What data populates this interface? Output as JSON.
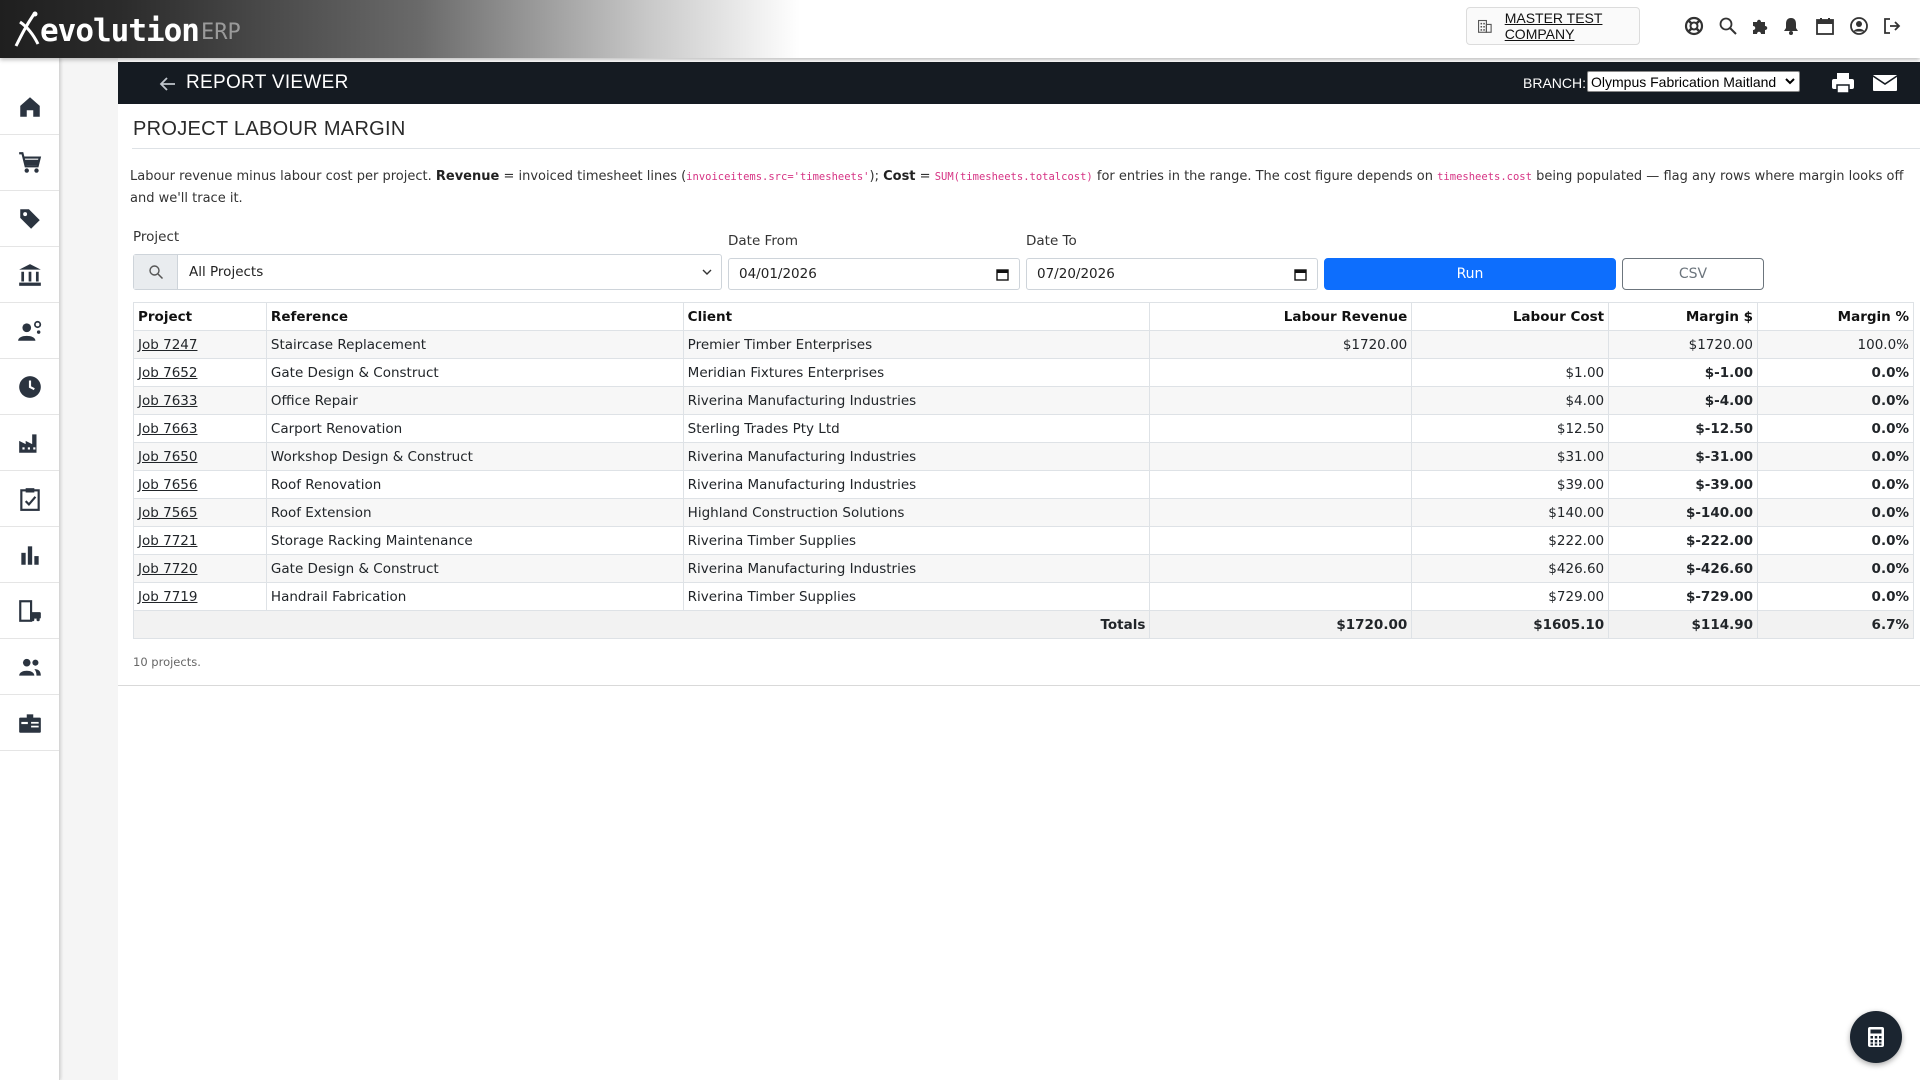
{
  "app": {
    "logo_main": "evolution",
    "logo_sub": "ERP",
    "company_name": "MASTER TEST COMPANY"
  },
  "header": {
    "title": "REPORT VIEWER",
    "branch_label": "BRANCH:",
    "branch_value": "Olympus Fabrication Maitland"
  },
  "report": {
    "title": "PROJECT LABOUR MARGIN",
    "description": {
      "t1": "Labour revenue minus labour cost per project. ",
      "revenue_label": "Revenue",
      "t2": " = invoiced timesheet lines (",
      "code1": "invoiceitems.src='timesheets'",
      "t3": "); ",
      "cost_label": "Cost",
      "t4": " = ",
      "code2": "SUM(timesheets.totalcost)",
      "t5": " for entries in the range. The cost figure depends on ",
      "code3": "timesheets.cost",
      "t6": " being populated — flag any rows where margin looks off and we'll trace it."
    },
    "filters": {
      "project_label": "Project",
      "project_value": "All Projects",
      "date_from_label": "Date From",
      "date_from_value": "04/01/2026",
      "date_to_label": "Date To",
      "date_to_value": "07/20/2026",
      "run_label": "Run",
      "csv_label": "CSV"
    },
    "columns": [
      "Project",
      "Reference",
      "Client",
      "Labour Revenue",
      "Labour Cost",
      "Margin $",
      "Margin %"
    ],
    "rows": [
      {
        "project": "Job 7247",
        "reference": "Staircase Replacement",
        "client": "Premier Timber Enterprises",
        "revenue": "$1720.00",
        "cost": "",
        "margin": "$1720.00",
        "pct": "100.0%",
        "negative": false
      },
      {
        "project": "Job 7652",
        "reference": "Gate Design & Construct",
        "client": "Meridian Fixtures Enterprises",
        "revenue": "",
        "cost": "$1.00",
        "margin": "$-1.00",
        "pct": "0.0%",
        "negative": true
      },
      {
        "project": "Job 7633",
        "reference": "Office Repair",
        "client": "Riverina Manufacturing Industries",
        "revenue": "",
        "cost": "$4.00",
        "margin": "$-4.00",
        "pct": "0.0%",
        "negative": true
      },
      {
        "project": "Job 7663",
        "reference": "Carport Renovation",
        "client": "Sterling Trades Pty Ltd",
        "revenue": "",
        "cost": "$12.50",
        "margin": "$-12.50",
        "pct": "0.0%",
        "negative": true
      },
      {
        "project": "Job 7650",
        "reference": "Workshop Design & Construct",
        "client": "Riverina Manufacturing Industries",
        "revenue": "",
        "cost": "$31.00",
        "margin": "$-31.00",
        "pct": "0.0%",
        "negative": true
      },
      {
        "project": "Job 7656",
        "reference": "Roof Renovation",
        "client": "Riverina Manufacturing Industries",
        "revenue": "",
        "cost": "$39.00",
        "margin": "$-39.00",
        "pct": "0.0%",
        "negative": true
      },
      {
        "project": "Job 7565",
        "reference": "Roof Extension",
        "client": "Highland Construction Solutions",
        "revenue": "",
        "cost": "$140.00",
        "margin": "$-140.00",
        "pct": "0.0%",
        "negative": true
      },
      {
        "project": "Job 7721",
        "reference": "Storage Racking Maintenance",
        "client": "Riverina Timber Supplies",
        "revenue": "",
        "cost": "$222.00",
        "margin": "$-222.00",
        "pct": "0.0%",
        "negative": true
      },
      {
        "project": "Job 7720",
        "reference": "Gate Design & Construct",
        "client": "Riverina Manufacturing Industries",
        "revenue": "",
        "cost": "$426.60",
        "margin": "$-426.60",
        "pct": "0.0%",
        "negative": true
      },
      {
        "project": "Job 7719",
        "reference": "Handrail Fabrication",
        "client": "Riverina Timber Supplies",
        "revenue": "",
        "cost": "$729.00",
        "margin": "$-729.00",
        "pct": "0.0%",
        "negative": true
      }
    ],
    "totals": {
      "label": "Totals",
      "revenue": "$1720.00",
      "cost": "$1605.10",
      "margin": "$114.90",
      "pct": "6.7%"
    },
    "count_note": "10 projects."
  },
  "colors": {
    "primary": "#0d6efd",
    "negative": "#c62828",
    "header_bar": "#151b22"
  },
  "icons": {
    "sidebar": [
      "home-icon",
      "cart-icon",
      "tag-icon",
      "bank-icon",
      "user-settings-icon",
      "clock-icon",
      "factory-icon",
      "clipboard-check-icon",
      "bar-chart-icon",
      "building-car-icon",
      "people-icon",
      "id-card-icon"
    ],
    "topbar": [
      "building-icon",
      "support-icon",
      "search-icon",
      "puzzle-icon",
      "bell-icon",
      "calendar-icon",
      "account-icon",
      "logout-icon"
    ]
  }
}
